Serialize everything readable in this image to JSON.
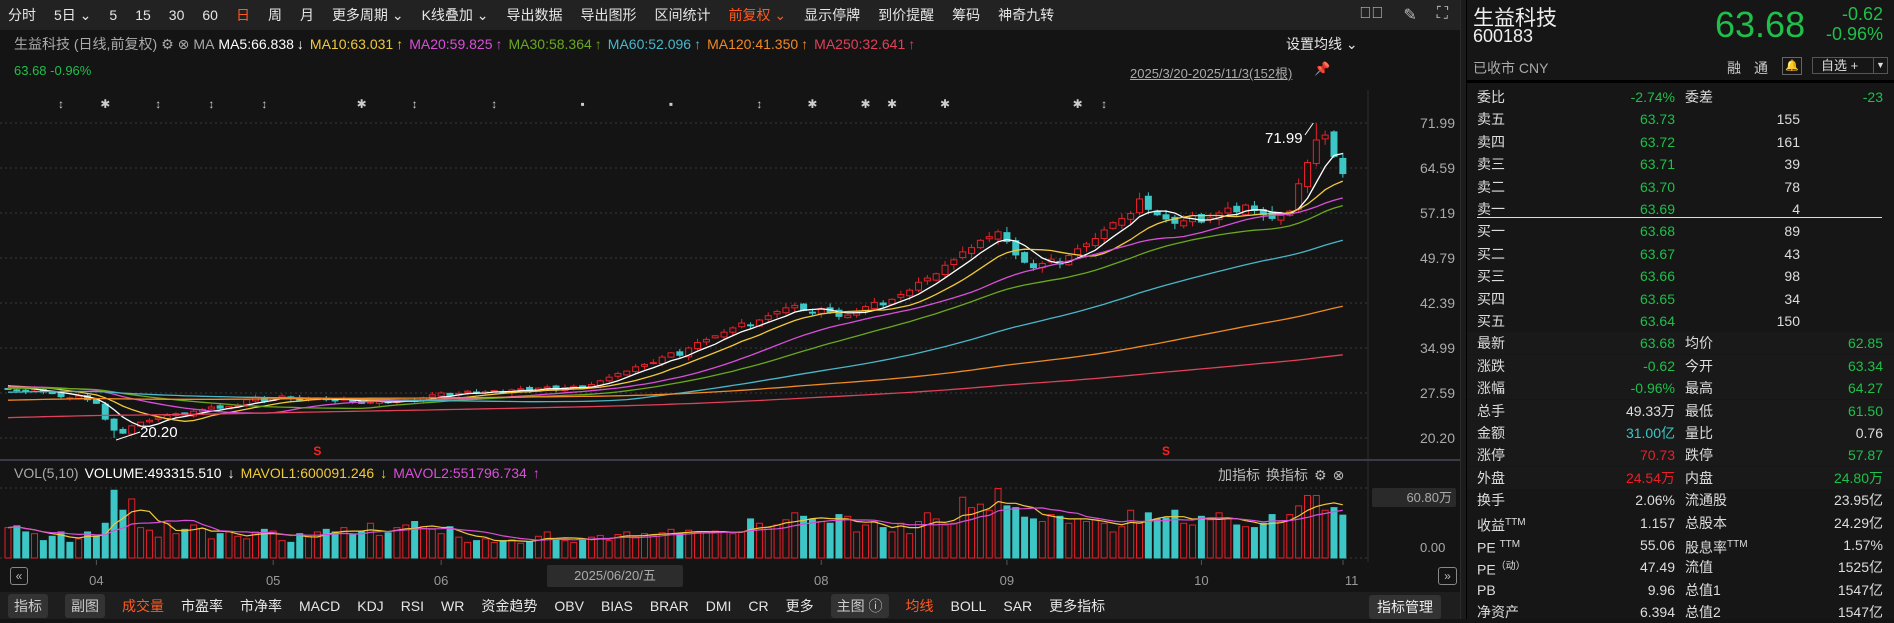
{
  "toolbar": {
    "items": [
      {
        "label": "分时"
      },
      {
        "label": "5日 ⌄"
      },
      {
        "label": "5"
      },
      {
        "label": "15"
      },
      {
        "label": "30"
      },
      {
        "label": "60"
      },
      {
        "label": "日",
        "active": true
      },
      {
        "label": "周"
      },
      {
        "label": "月"
      },
      {
        "label": "更多周期 ⌄"
      },
      {
        "label": "K线叠加 ⌄"
      },
      {
        "label": "导出数据"
      },
      {
        "label": "导出图形"
      },
      {
        "label": "区间统计"
      },
      {
        "label": "前复权 ⌄",
        "active": true
      },
      {
        "label": "显示停牌"
      },
      {
        "label": "到价提醒"
      },
      {
        "label": "筹码"
      },
      {
        "label": "神奇九转"
      }
    ],
    "icons": [
      "circle-chevron-icon",
      "brush-icon",
      "fullscreen-icon"
    ]
  },
  "ma_legend": {
    "title": "生益科技 (日线,前复权)",
    "ma_label": "MA",
    "items": [
      {
        "text": "MA5:66.838",
        "arrow": "↓",
        "color": "#ffffff"
      },
      {
        "text": "MA10:63.031",
        "arrow": "↑",
        "color": "#f0c93a"
      },
      {
        "text": "MA20:59.825",
        "arrow": "↑",
        "color": "#d94fd9"
      },
      {
        "text": "MA30:58.364",
        "arrow": "↑",
        "color": "#6aa81e"
      },
      {
        "text": "MA60:52.096",
        "arrow": "↑",
        "color": "#4ab6c8"
      },
      {
        "text": "MA120:41.350",
        "arrow": "↑",
        "color": "#f08a24"
      },
      {
        "text": "MA250:32.641",
        "arrow": "↑",
        "color": "#e0405a"
      }
    ],
    "set_ma": "设置均线 ⌄",
    "price_change": "63.68 -0.96%",
    "range": "2025/3/20-2025/11/3(152根)"
  },
  "colors": {
    "up": "#e8202a",
    "down": "#3cc6c6",
    "grid": "#3a3a3a",
    "positive": "#e8202a",
    "negative": "#1fbf4a"
  },
  "chart_data": {
    "type": "candlestick",
    "bars": 152,
    "price_axis": [
      "71.99",
      "64.59",
      "57.19",
      "49.79",
      "42.39",
      "34.99",
      "27.59",
      "20.20"
    ],
    "ylim": [
      20.2,
      71.99
    ],
    "closes": [
      28.2,
      28.0,
      27.9,
      28.3,
      27.8,
      27.5,
      27.0,
      26.8,
      27.1,
      26.5,
      25.9,
      23.3,
      21.5,
      21.0,
      22.2,
      22.8,
      23.1,
      23.5,
      23.9,
      24.2,
      24.0,
      24.6,
      24.9,
      25.3,
      25.1,
      25.4,
      25.6,
      26.5,
      26.9,
      26.3,
      26.6,
      27.1,
      26.8,
      26.4,
      26.7,
      26.8,
      26.5,
      26.3,
      26.6,
      26.2,
      25.9,
      26.1,
      26.4,
      26.0,
      26.2,
      26.5,
      26.3,
      26.8,
      27.3,
      27.6,
      27.2,
      27.5,
      27.9,
      27.6,
      27.8,
      28.0,
      27.7,
      28.1,
      28.3,
      28.0,
      28.4,
      28.6,
      28.2,
      28.5,
      28.7,
      28.4,
      29.0,
      29.6,
      30.2,
      30.8,
      31.2,
      31.9,
      32.3,
      32.6,
      33.5,
      34.2,
      33.8,
      35.0,
      35.9,
      36.4,
      37.0,
      37.6,
      38.3,
      39.1,
      38.7,
      39.6,
      40.3,
      41.0,
      41.6,
      42.0,
      41.2,
      40.8,
      41.5,
      40.9,
      40.2,
      40.4,
      41.0,
      41.8,
      42.5,
      42.1,
      43.0,
      43.8,
      44.5,
      45.8,
      46.5,
      47.2,
      48.6,
      49.5,
      50.8,
      51.5,
      52.7,
      53.3,
      54.1,
      52.5,
      50.3,
      49.1,
      48.2,
      48.9,
      49.6,
      48.8,
      50.2,
      51.3,
      52.1,
      53.0,
      54.4,
      55.6,
      56.3,
      57.1,
      59.5,
      57.8,
      56.9,
      56.2,
      55.5,
      55.9,
      56.8,
      55.7,
      56.4,
      57.2,
      58.0,
      57.4,
      58.5,
      57.6,
      56.9,
      56.3,
      56.8,
      57.5,
      62.0,
      65.5,
      69.2,
      70.0,
      66.5,
      63.68
    ],
    "high_mark": {
      "bar": 148,
      "value": "71.99"
    },
    "low_mark": {
      "bar": 12,
      "value": "20.20"
    },
    "ma_periods": [
      5,
      10,
      20,
      30,
      60,
      120,
      250
    ],
    "signals": [
      {
        "bar": 35,
        "text": "S"
      },
      {
        "bar": 131,
        "text": "S"
      }
    ],
    "event_markers": [
      {
        "bar": 6,
        "icon": "updown-arrow-icon"
      },
      {
        "bar": 11,
        "icon": "star-icon"
      },
      {
        "bar": 17,
        "icon": "updown-arrow-icon"
      },
      {
        "bar": 23,
        "icon": "updown-arrow-icon"
      },
      {
        "bar": 29,
        "icon": "updown-arrow-icon"
      },
      {
        "bar": 40,
        "icon": "star-icon"
      },
      {
        "bar": 46,
        "icon": "updown-arrow-icon"
      },
      {
        "bar": 55,
        "icon": "updown-arrow-icon"
      },
      {
        "bar": 65,
        "icon": "square-icon"
      },
      {
        "bar": 75,
        "icon": "square-icon"
      },
      {
        "bar": 85,
        "icon": "updown-arrow-icon"
      },
      {
        "bar": 91,
        "icon": "star-icon"
      },
      {
        "bar": 97,
        "icon": "star-icon"
      },
      {
        "bar": 100,
        "icon": "star-icon"
      },
      {
        "bar": 106,
        "icon": "star-icon"
      },
      {
        "bar": 121,
        "icon": "star-icon"
      },
      {
        "bar": 124,
        "icon": "updown-arrow-icon"
      }
    ],
    "months": [
      {
        "label": "04",
        "bar": 10
      },
      {
        "label": "05",
        "bar": 30
      },
      {
        "label": "06",
        "bar": 49
      },
      {
        "label": "08",
        "bar": 92
      },
      {
        "label": "09",
        "bar": 113
      },
      {
        "label": "10",
        "bar": 135
      },
      {
        "label": "11",
        "bar": 152
      }
    ],
    "volume": {
      "unit": "万手",
      "values": [
        35,
        37,
        30,
        28,
        20,
        25,
        30,
        18,
        22,
        30,
        25,
        40,
        78,
        55,
        68,
        35,
        32,
        24,
        40,
        28,
        33,
        38,
        34,
        22,
        28,
        30,
        25,
        22,
        30,
        33,
        31,
        20,
        18,
        28,
        25,
        30,
        33,
        30,
        35,
        27,
        30,
        40,
        26,
        29,
        35,
        38,
        42,
        36,
        33,
        28,
        36,
        24,
        18,
        20,
        22,
        18,
        20,
        21,
        17,
        19,
        25,
        30,
        22,
        20,
        18,
        22,
        24,
        26,
        20,
        27,
        30,
        24,
        28,
        26,
        29,
        33,
        28,
        32,
        30,
        29,
        31,
        30,
        28,
        30,
        45,
        40,
        35,
        38,
        44,
        52,
        48,
        45,
        42,
        40,
        50,
        48,
        30,
        38,
        42,
        35,
        30,
        40,
        28,
        42,
        52,
        45,
        38,
        40,
        70,
        58,
        62,
        55,
        80,
        60,
        58,
        47,
        45,
        42,
        50,
        48,
        40,
        45,
        42,
        44,
        40,
        30,
        36,
        55,
        40,
        52,
        45,
        46,
        55,
        40,
        38,
        48,
        44,
        52,
        45,
        38,
        36,
        35,
        40,
        50,
        42,
        50,
        60,
        72,
        72,
        55,
        58,
        49.33
      ],
      "ylim": [
        0,
        80.6
      ],
      "mavol_periods": [
        5,
        10
      ]
    }
  },
  "volume_panel": {
    "name": "VOL(5,10)",
    "volume": "VOLUME:493315.510",
    "volume_arrow": "↓",
    "mavol1": "MAVOL1:600091.246",
    "mavol1_arrow": "↓",
    "mavol2": "MAVOL2:551796.734",
    "mavol2_arrow": "↑",
    "add_indicator": "加指标",
    "switch_indicator": "换指标",
    "axis_top": "60.80万",
    "axis_zero": "0.00"
  },
  "xaxis": {
    "date_tip": "2025/06/20/五",
    "scroll_left": "«",
    "scroll_right": "»"
  },
  "bottombar": {
    "items": [
      {
        "label": "指标",
        "button": true
      },
      {
        "label": "副图",
        "button": true
      },
      {
        "label": "成交量",
        "active": true
      },
      {
        "label": "市盈率"
      },
      {
        "label": "市净率"
      },
      {
        "label": "MACD"
      },
      {
        "label": "KDJ"
      },
      {
        "label": "RSI"
      },
      {
        "label": "WR"
      },
      {
        "label": "资金趋势"
      },
      {
        "label": "OBV"
      },
      {
        "label": "BIAS"
      },
      {
        "label": "BRAR"
      },
      {
        "label": "DMI"
      },
      {
        "label": "CR"
      },
      {
        "label": "更多"
      },
      {
        "label": "主图 ⓘ",
        "button": true
      },
      {
        "label": "均线",
        "active": true
      },
      {
        "label": "BOLL"
      },
      {
        "label": "SAR"
      },
      {
        "label": "更多指标"
      }
    ],
    "manage": "指标管理"
  },
  "quote": {
    "name": "生益科技",
    "code": "600183",
    "status": "已收市 CNY",
    "price": "63.68",
    "change": "-0.62",
    "change_pct": "-0.96%",
    "rong": "融",
    "tong": "通",
    "favorite": "自选 +"
  },
  "orderbook": {
    "weibi_label": "委比",
    "weibi": "-2.74%",
    "weicha_label": "委差",
    "weicha": "-23",
    "asks": [
      {
        "label": "卖五",
        "price": "63.73",
        "vol": "155"
      },
      {
        "label": "卖四",
        "price": "63.72",
        "vol": "161"
      },
      {
        "label": "卖三",
        "price": "63.71",
        "vol": "39"
      },
      {
        "label": "卖二",
        "price": "63.70",
        "vol": "78"
      },
      {
        "label": "卖一",
        "price": "63.69",
        "vol": "4"
      }
    ],
    "bids": [
      {
        "label": "买一",
        "price": "63.68",
        "vol": "89"
      },
      {
        "label": "买二",
        "price": "63.67",
        "vol": "43"
      },
      {
        "label": "买三",
        "price": "63.66",
        "vol": "98"
      },
      {
        "label": "买四",
        "price": "63.65",
        "vol": "34"
      },
      {
        "label": "买五",
        "price": "63.64",
        "vol": "150"
      }
    ]
  },
  "stats": [
    {
      "l1": "最新",
      "v1": "63.68",
      "c1": "#1fbf4a",
      "l2": "均价",
      "v2": "62.85",
      "c2": "#1fbf4a"
    },
    {
      "l1": "涨跌",
      "v1": "-0.62",
      "c1": "#1fbf4a",
      "l2": "今开",
      "v2": "63.34",
      "c2": "#1fbf4a"
    },
    {
      "l1": "涨幅",
      "v1": "-0.96%",
      "c1": "#1fbf4a",
      "l2": "最高",
      "v2": "64.27",
      "c2": "#1fbf4a"
    },
    {
      "l1": "总手",
      "v1": "49.33万",
      "c1": "#dddddd",
      "l2": "最低",
      "v2": "61.50",
      "c2": "#1fbf4a"
    },
    {
      "l1": "金额",
      "v1": "31.00亿",
      "c1": "#3cc6c6",
      "l2": "量比",
      "v2": "0.76",
      "c2": "#dddddd"
    },
    {
      "l1": "涨停",
      "v1": "70.73",
      "c1": "#e8202a",
      "l2": "跌停",
      "v2": "57.87",
      "c2": "#1fbf4a"
    },
    {
      "l1": "外盘",
      "v1": "24.54万",
      "c1": "#e8202a",
      "l2": "内盘",
      "v2": "24.80万",
      "c2": "#1fbf4a"
    },
    {
      "l1": "换手",
      "v1": "2.06%",
      "c1": "#dddddd",
      "l2": "流通股",
      "v2": "23.95亿",
      "c2": "#dddddd"
    },
    {
      "l1": "收益",
      "s1": "TTM",
      "v1": "1.157",
      "c1": "#dddddd",
      "l2": "总股本",
      "v2": "24.29亿",
      "c2": "#dddddd"
    },
    {
      "l1": "PE ",
      "s1": "TTM",
      "v1": "55.06",
      "c1": "#dddddd",
      "l2": "股息率",
      "s2": "TTM",
      "v2": "1.57%",
      "c2": "#dddddd"
    },
    {
      "l1": "PE",
      "s1": "（动）",
      "v1": "47.49",
      "c1": "#dddddd",
      "l2": "流值",
      "v2": "1525亿",
      "c2": "#dddddd"
    },
    {
      "l1": "PB",
      "v1": "9.96",
      "c1": "#dddddd",
      "l2": "总值1",
      "v2": "1547亿",
      "c2": "#dddddd"
    },
    {
      "l1": "净资产",
      "v1": "6.394",
      "c1": "#dddddd",
      "l2": "总值2",
      "v2": "1547亿",
      "c2": "#dddddd"
    }
  ]
}
